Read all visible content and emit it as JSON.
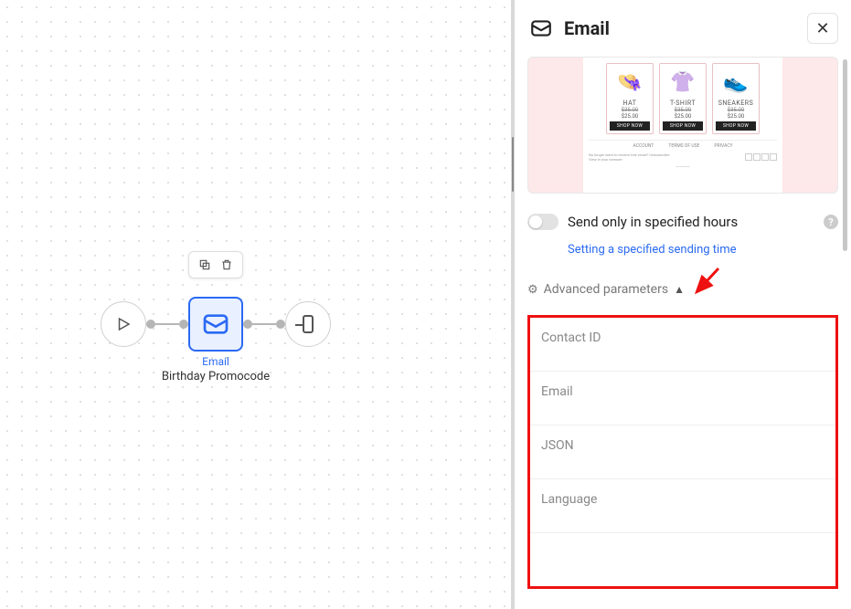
{
  "panel": {
    "title": "Email",
    "toggle_label": "Send only in specified hours",
    "toggle_link": "Setting a specified sending time",
    "advanced_label": "Advanced parameters",
    "params": {
      "contact_id": "Contact ID",
      "email": "Email",
      "json": "JSON",
      "language": "Language"
    }
  },
  "preview": {
    "products": [
      {
        "name": "HAT",
        "price": "$35.00",
        "price2": "$25.00",
        "btn": "SHOP NOW"
      },
      {
        "name": "T-SHIRT",
        "price": "$35.00",
        "price2": "$25.00",
        "btn": "SHOP NOW"
      },
      {
        "name": "SNEAKERS",
        "price": "$35.00",
        "price2": "$25.00",
        "btn": "SHOP NOW"
      }
    ],
    "footer": {
      "a": "ACCOUNT",
      "b": "TERMS OF USE",
      "c": "PRIVACY"
    },
    "unsub": "No longer want to receive this email? Unsubscribe",
    "view": "View in your browser"
  },
  "canvas": {
    "node_type": "Email",
    "node_title": "Birthday Promocode"
  }
}
